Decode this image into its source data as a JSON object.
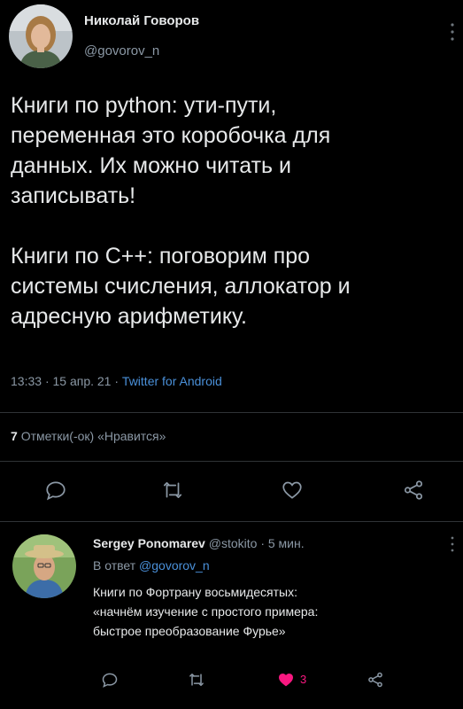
{
  "main_tweet": {
    "author_name": "Николай Говоров",
    "author_handle": "@govorov_n",
    "text_p1_lines": [
      "Книги по python: ути-пути,",
      "переменная это коробочка для",
      "данных. Их можно читать и",
      "записывать!"
    ],
    "text_p2_lines": [
      "Книги по C++: поговорим про",
      "системы счисления, аллокатор и",
      "адресную арифметику."
    ],
    "time": "13:33",
    "date": "15 апр. 21",
    "source": "Twitter for Android",
    "likes_count": "7",
    "likes_label": "Отметки(-ок) «Нравится»"
  },
  "reply": {
    "author_name": "Sergey Ponomarev",
    "author_handle": "@stokito",
    "time_ago": "5 мин.",
    "reply_prefix": "В ответ",
    "reply_to": "@govorov_n",
    "text_lines": [
      "Книги по Фортрану восьмидесятых:",
      "«начнём изучение с простого примера:",
      "быстрое преобразование Фурье»"
    ],
    "like_count": "3"
  },
  "separator": "·",
  "icons": {
    "reply": "reply-icon",
    "retweet": "retweet-icon",
    "like": "heart-icon",
    "share": "share-icon",
    "menu": "more-icon"
  },
  "colors": {
    "background": "#000000",
    "text": "#e7e9ea",
    "muted": "#8b98a5",
    "link": "#4a90d9",
    "like_active": "#f91880",
    "divider": "#2f3336"
  }
}
